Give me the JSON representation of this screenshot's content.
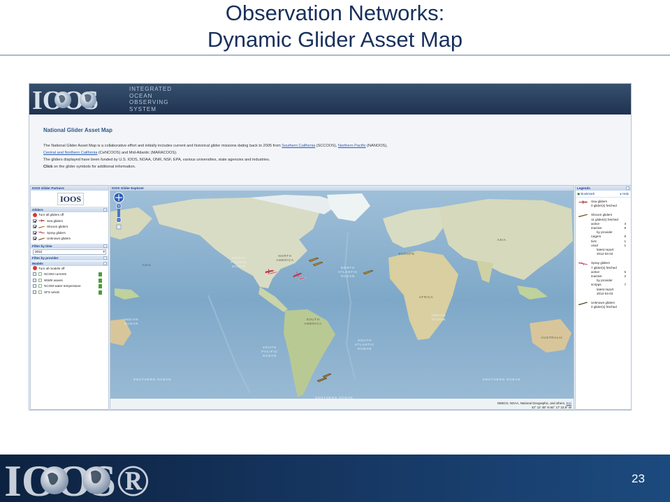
{
  "slide": {
    "title_line1": "Observation Networks:",
    "title_line2": "Dynamic Glider Asset Map",
    "page_number": "23",
    "footer_logo": "IOOS®"
  },
  "site": {
    "logo": "IOOS",
    "org_lines": [
      "INTEGRATED",
      "OCEAN",
      "OBSERVING",
      "SYSTEM"
    ]
  },
  "intro": {
    "title": "National Glider Asset Map",
    "text1": "The National Glider Asset Map is a collaborative effort and initially includes current and historical glider missions dating back to 2005 from ",
    "link1": "Southern California",
    "text2": " (SCCOOS), ",
    "link2": "Northern Pacific",
    "text3": " (NANOOS),",
    "link3": "Central and Northern California",
    "text4": " (CeNCOOS) and Mid-Atlantic (MARACOOS).",
    "text5": "The gliders displayed have been funded by U.S. IOOS, NOAA, ONR, NSF, EPA, various universities, state agencies and industries.",
    "click_bold": "Click",
    "click_rest": " on the glider symbols for additional information."
  },
  "left_panel": {
    "partners_header": "IOOS Glider Partners",
    "partners_logo": "IOOS",
    "gliders_header": "Gliders",
    "turn_off_gliders": "Turn all gliders off",
    "glider_types": [
      {
        "label": "Sea gliders",
        "checked": true,
        "color": "#b03030"
      },
      {
        "label": "Slocum gliders",
        "checked": true,
        "color": "#c08a20"
      },
      {
        "label": "Spray gliders",
        "checked": true,
        "color": "#c23a55"
      },
      {
        "label": "Unknown gliders",
        "checked": true,
        "color": "#a87a30"
      }
    ],
    "filter_year_header": "Filter by time",
    "year_value": "2012",
    "filter_provider_header": "Filter by provider",
    "models_header": "Models",
    "turn_off_models": "Turn all models off",
    "models": [
      {
        "label": "NCOM currents"
      },
      {
        "label": "WWIII waves"
      },
      {
        "label": "NCOM water temperature"
      },
      {
        "label": "SFS winds"
      }
    ]
  },
  "map": {
    "header": "IOOS Glider Explorer",
    "attribution": "GEBCO, NOAA, National Geographic, and others.",
    "attribution_link": "Esri",
    "coordinates": "42° 12' 35\" N  64° 17' 22.8\" W",
    "labels": {
      "north_pacific": [
        "NORTH",
        "PACIFIC",
        "OCEAN"
      ],
      "north_atlantic": [
        "NORTH",
        "ATLANTIC",
        "OCEAN"
      ],
      "south_pacific": [
        "SOUTH",
        "PACIFIC",
        "OCEAN"
      ],
      "south_atlantic": [
        "SOUTH",
        "ATLANTIC",
        "OCEAN"
      ],
      "indian": [
        "INDIAN",
        "OCEAN"
      ],
      "southern_left": "SOUTHERN OCEAN",
      "southern_mid": "SOUTHERN OCEAN",
      "southern_right": "SOUTHERN OCEAN",
      "north_america": [
        "NORTH",
        "AMERICA"
      ],
      "south_america": [
        "SOUTH",
        "AMERICA"
      ],
      "africa": "AFRICA",
      "asia_left": "ASIA",
      "asia_right": "ASIA",
      "europe": "EUROPE",
      "australia": "AUSTRALIA"
    }
  },
  "legend": {
    "header": "Legends",
    "tools_left": "Bookmark",
    "tools_right": "Help",
    "sea": {
      "title": "Sea gliders",
      "fetched": "0 glider(s) fetched",
      "color": "#8a2020"
    },
    "slocum": {
      "title": "Slocum gliders",
      "fetched": "11 glider(s) fetched",
      "rows": [
        {
          "label": "active",
          "value": "3"
        },
        {
          "label": "inactive",
          "value": "8"
        },
        {
          "label": "by provider",
          "value": ""
        },
        {
          "label": "rutgers",
          "value": "9"
        },
        {
          "label": "twrc",
          "value": "1"
        },
        {
          "label": "usud",
          "value": "1"
        },
        {
          "label": "latest report",
          "value": ""
        },
        {
          "label": "2012-04-02",
          "value": ""
        }
      ],
      "color": "#c08a20"
    },
    "spray": {
      "title": "Spray gliders",
      "fetched": "7 glider(s) fetched",
      "rows": [
        {
          "label": "active",
          "value": "5"
        },
        {
          "label": "inactive",
          "value": "2"
        },
        {
          "label": "by provider",
          "value": ""
        },
        {
          "label": "scripps",
          "value": "7"
        },
        {
          "label": "latest report",
          "value": ""
        },
        {
          "label": "2012-04-02",
          "value": ""
        }
      ],
      "color": "#c23a55"
    },
    "unknown": {
      "title": "Unknown gliders",
      "fetched": "0 glider(s) fetched",
      "color": "#a87a30"
    }
  }
}
